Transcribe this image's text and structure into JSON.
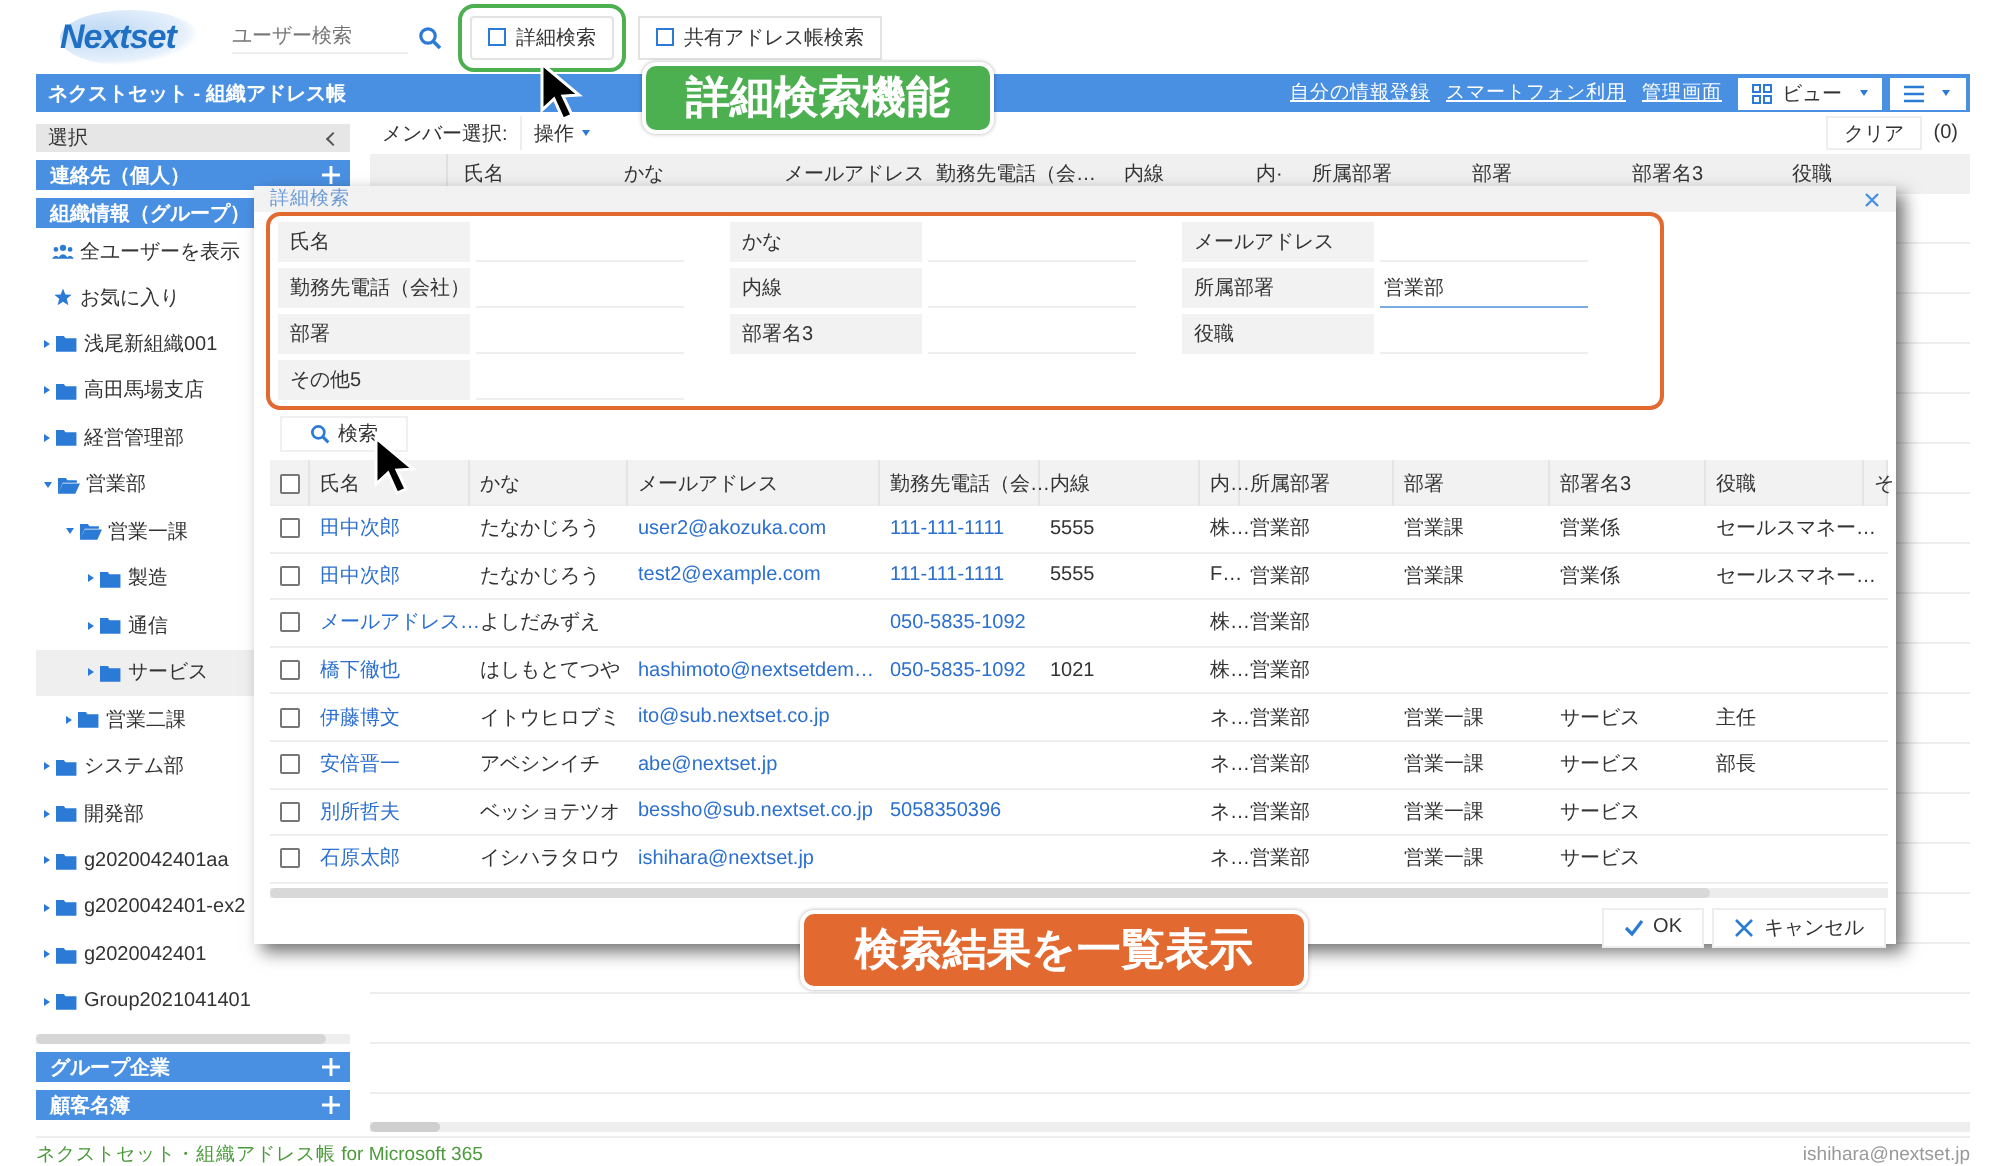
{
  "header": {
    "logo": "Nextset",
    "search": {
      "placeholder": "ユーザー検索"
    },
    "buttons": [
      {
        "label": "詳細検索"
      },
      {
        "label": "共有アドレス帳検索"
      }
    ]
  },
  "app_bar": {
    "title": "ネクストセット - 組織アドレス帳",
    "links": [
      "自分の情報登録",
      "スマートフォン利用",
      "管理画面"
    ],
    "view_button": "ビュー"
  },
  "sidebar": {
    "header": "選択",
    "sections_top": [
      {
        "label": "連絡先（個人）",
        "has_add": true
      },
      {
        "label": "組織情報（グループ）",
        "has_add": false
      }
    ],
    "shortcuts": [
      {
        "kind": "users",
        "label": "全ユーザーを表示"
      },
      {
        "kind": "star",
        "label": "お気に入り"
      }
    ],
    "tree": [
      {
        "label": "浅尾新組織001",
        "expanded": false,
        "selected": false
      },
      {
        "label": "高田馬場支店",
        "expanded": false,
        "selected": false
      },
      {
        "label": "経営管理部",
        "expanded": false,
        "selected": false
      },
      {
        "label": "営業部",
        "expanded": true,
        "selected": false,
        "children": [
          {
            "label": "営業一課",
            "expanded": true,
            "selected": false,
            "children": [
              {
                "label": "製造",
                "expanded": false,
                "selected": false
              },
              {
                "label": "通信",
                "expanded": false,
                "selected": false
              },
              {
                "label": "サービス",
                "expanded": false,
                "selected": true
              }
            ]
          },
          {
            "label": "営業二課",
            "expanded": false,
            "selected": false
          }
        ]
      },
      {
        "label": "システム部",
        "expanded": false,
        "selected": false
      },
      {
        "label": "開発部",
        "expanded": false,
        "selected": false
      },
      {
        "label": "g2020042401aa",
        "expanded": false,
        "selected": false
      },
      {
        "label": "g2020042401-ex2",
        "expanded": false,
        "selected": false
      },
      {
        "label": "g2020042401",
        "expanded": false,
        "selected": false
      },
      {
        "label": "Group2021041401",
        "expanded": false,
        "selected": false
      }
    ],
    "sections_bottom": [
      {
        "label": "グループ企業",
        "has_add": true
      },
      {
        "label": "顧客名簿",
        "has_add": true
      }
    ]
  },
  "toolbar": {
    "member_select_label": "メンバー選択:",
    "action_button": "操作",
    "clear_button": "クリア",
    "count": "(0)"
  },
  "background_table": {
    "columns": [
      "氏名",
      "かな",
      "メールアドレス",
      "勤務先電話（会…",
      "内線",
      "内·",
      "所属部署",
      "部署",
      "部署名3",
      "役職"
    ]
  },
  "dialog": {
    "title": "詳細検索",
    "fields": [
      {
        "label": "氏名"
      },
      {
        "label": "かな"
      },
      {
        "label": "メールアドレス"
      },
      {
        "label": "勤務先電話（会社）"
      },
      {
        "label": "内線"
      },
      {
        "label": "所属部署",
        "value": "営業部"
      },
      {
        "label": "部署"
      },
      {
        "label": "部署名3"
      },
      {
        "label": "役職"
      },
      {
        "label": "その他5"
      }
    ],
    "search_button": "検索",
    "results": {
      "header_checked": false,
      "columns": [
        "氏名",
        "かな",
        "メールアドレス",
        "勤務先電話（会…",
        "内線",
        "内…",
        "所属部署",
        "部署",
        "部署名3",
        "役職",
        "そ"
      ],
      "rows": [
        {
          "checked": false,
          "name": "田中次郎",
          "kana": "たなかじろう",
          "email": "user2@akozuka.com",
          "phone": "111-111-1111",
          "ext": "5555",
          "column_7": "株…",
          "dept": "営業部",
          "section": "営業課",
          "section3": "営業係",
          "title": "セールスマネー…"
        },
        {
          "checked": false,
          "name": "田中次郎",
          "kana": "たなかじろう",
          "email": "test2@example.com",
          "phone": "111-111-1111",
          "ext": "5555",
          "column_7": "F…",
          "dept": "営業部",
          "section": "営業課",
          "section3": "営業係",
          "title": "セールスマネー…"
        },
        {
          "checked": false,
          "name": "メールアドレス…",
          "kana": "よしだみずえ",
          "phone": "050-5835-1092",
          "column_7": "株…",
          "dept": "営業部"
        },
        {
          "checked": false,
          "name": "橋下徹也",
          "kana": "はしもとてつや",
          "email": "hashimoto@nextsetdem…",
          "phone": "050-5835-1092",
          "ext": "1021",
          "column_7": "株…",
          "dept": "営業部"
        },
        {
          "checked": false,
          "name": "伊藤博文",
          "kana": "イトウヒロブミ",
          "email": "ito@sub.nextset.co.jp",
          "column_7": "ネ…",
          "dept": "営業部",
          "section": "営業一課",
          "section3": "サービス",
          "title": "主任"
        },
        {
          "checked": false,
          "name": "安倍晋一",
          "kana": "アベシンイチ",
          "email": "abe@nextset.jp",
          "column_7": "ネ…",
          "dept": "営業部",
          "section": "営業一課",
          "section3": "サービス",
          "title": "部長"
        },
        {
          "checked": false,
          "name": "別所哲夫",
          "kana": "ベッショテツオ",
          "email": "bessho@sub.nextset.co.jp",
          "phone": "5058350396",
          "column_7": "ネ…",
          "dept": "営業部",
          "section": "営業一課",
          "section3": "サービス"
        },
        {
          "checked": false,
          "name": "石原太郎",
          "kana": "イシハラタロウ",
          "email": "ishihara@nextset.jp",
          "column_7": "ネ…",
          "dept": "営業部",
          "section": "営業一課",
          "section3": "サービス"
        }
      ]
    },
    "ok_button": "OK",
    "cancel_button": "キャンセル"
  },
  "callouts": [
    {
      "text": "詳細検索機能",
      "color": "#4caf50"
    },
    {
      "text": "検索結果を一覧表示",
      "color": "#e2692f"
    }
  ],
  "footer": {
    "product": "ネクストセット・組織アドレス帳 for Microsoft 365",
    "user": "ishihara@nextset.jp"
  }
}
